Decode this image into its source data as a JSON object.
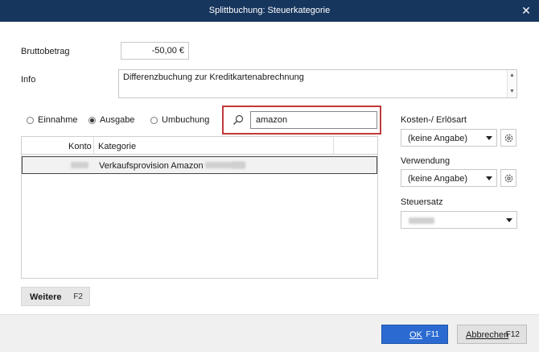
{
  "window": {
    "title": "Splittbuchung: Steuerkategorie",
    "close_glyph": "✕",
    "close_icon": "close-icon"
  },
  "form": {
    "amount_label": "Bruttobetrag",
    "amount_value": "-50,00 €",
    "info_label": "Info",
    "info_value": "Differenzbuchung zur Kreditkartenabrechnung",
    "scroll_up": "▲",
    "scroll_down": "▼"
  },
  "type_options": [
    {
      "label": "Einnahme",
      "checked": false
    },
    {
      "label": "Ausgabe",
      "checked": true
    },
    {
      "label": "Umbuchung",
      "checked": false
    }
  ],
  "search": {
    "value": "amazon",
    "icon": "search-icon",
    "highlight_color": "#c0393b"
  },
  "table": {
    "columns": [
      "Konto",
      "Kategorie"
    ],
    "rows": [
      {
        "kategorie": "Verkaufsprovision Amazon"
      }
    ]
  },
  "more_button": {
    "label": "Weitere",
    "shortcut": "F2"
  },
  "right_panel": {
    "cost_type_label": "Kosten-/ Erlösart",
    "cost_type_value": "(keine Angabe)",
    "usage_label": "Verwendung",
    "usage_value": "(keine Angabe)",
    "tax_rate_label": "Steuersatz"
  },
  "footer": {
    "ok_label": "OK",
    "ok_shortcut": "F11",
    "cancel_label": "Abbrechen",
    "cancel_shortcut": "F12"
  },
  "colors": {
    "titlebar": "#17365e",
    "primary_button": "#2b6bd1"
  }
}
